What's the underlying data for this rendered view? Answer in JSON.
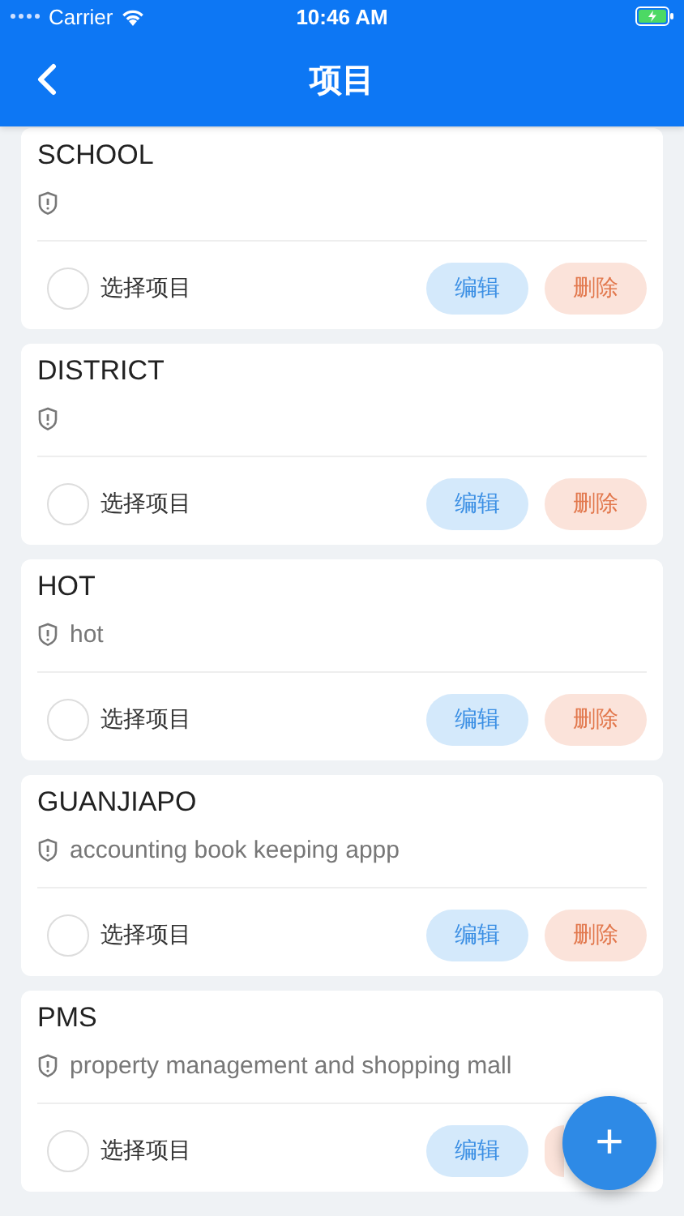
{
  "status_bar": {
    "carrier": "Carrier",
    "time": "10:46 AM"
  },
  "nav": {
    "title": "项目"
  },
  "projects": [
    {
      "name": "SCHOOL",
      "select_label": "选择项目",
      "checked": false,
      "edit_label": "编辑",
      "delete_label": "删除"
    },
    {
      "name": "DISTRICT",
      "select_label": "选择项目",
      "checked": false,
      "edit_label": "编辑",
      "delete_label": "删除"
    },
    {
      "name": "HOT",
      "description": "hot",
      "select_label": "选择项目",
      "checked": false,
      "edit_label": "编辑",
      "delete_label": "删除"
    },
    {
      "name": "GUANJIAPO",
      "description": "accounting book keeping appp",
      "select_label": "选择项目",
      "checked": false,
      "edit_label": "编辑",
      "delete_label": "删除"
    },
    {
      "name": "PMS",
      "description": "property management and shopping mall",
      "select_label": "选择项目",
      "checked": false,
      "edit_label": "编辑"
    }
  ],
  "fab": {
    "label": "+"
  }
}
